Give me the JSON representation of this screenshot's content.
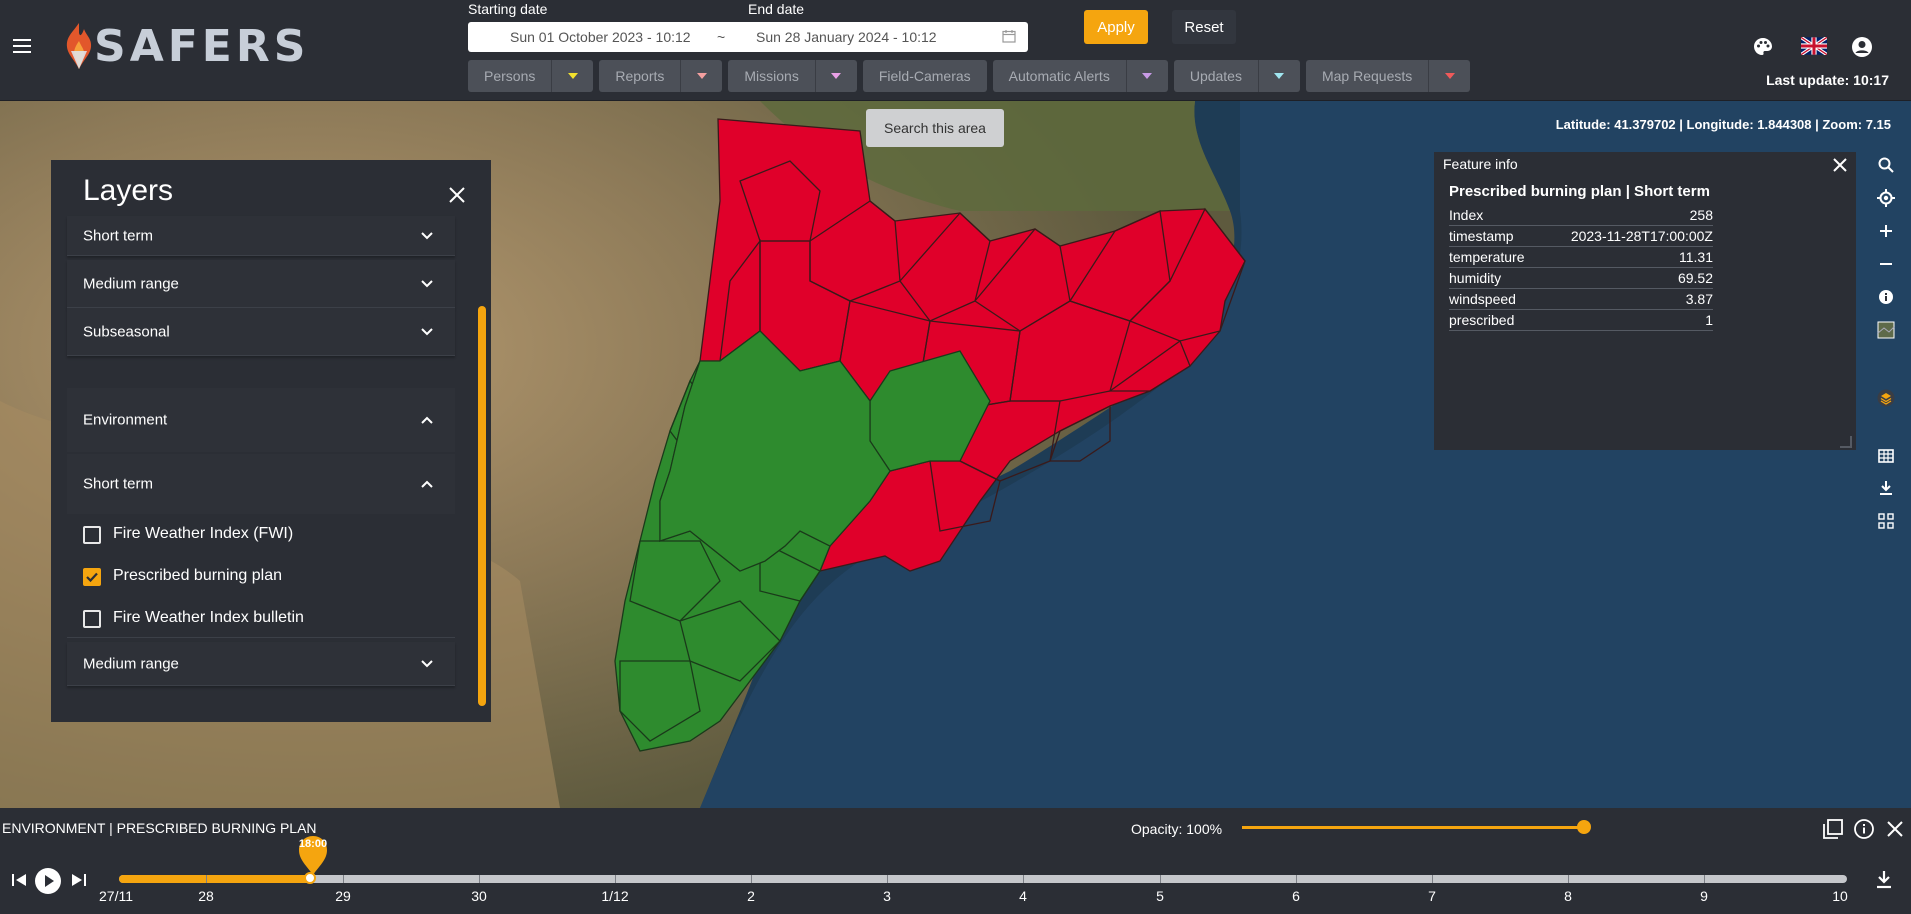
{
  "header": {
    "logo_text": "SAFERS",
    "starting_date_label": "Starting date",
    "end_date_label": "End date",
    "start_value": "Sun 01 October 2023 - 10:12",
    "separator": "~",
    "end_value": "Sun 28 January 2024 - 10:12",
    "apply_label": "Apply",
    "reset_label": "Reset",
    "filters": [
      {
        "label": "Persons",
        "color": "#f2e12e"
      },
      {
        "label": "Reports",
        "color": "#f4a0a0"
      },
      {
        "label": "Missions",
        "color": "#e9a0e6"
      },
      {
        "label": "Field-Cameras"
      },
      {
        "label": "Automatic Alerts",
        "color": "#c89be6"
      },
      {
        "label": "Updates",
        "color": "#a0e6f0"
      },
      {
        "label": "Map Requests",
        "color": "#f05a5a"
      }
    ],
    "last_update": "Last update: 10:17"
  },
  "map": {
    "search_area": "Search this area",
    "coordinates": "Latitude: 41.379702 | Longitude: 1.844308 | Zoom: 7.15"
  },
  "layers": {
    "title": "Layers",
    "rows": [
      {
        "label": "Short term"
      },
      {
        "label": "Medium range"
      },
      {
        "label": "Subseasonal"
      },
      {
        "label": "Environment"
      },
      {
        "label": "Short term"
      },
      {
        "label": "Medium range"
      }
    ],
    "checkboxes": [
      {
        "label": "Fire Weather Index (FWI)",
        "checked": false
      },
      {
        "label": "Prescribed burning plan",
        "checked": true
      },
      {
        "label": "Fire Weather Index bulletin",
        "checked": false
      }
    ]
  },
  "feature_info": {
    "header": "Feature info",
    "title": "Prescribed burning plan | Short term",
    "rows": [
      {
        "key": "Index",
        "value": "258"
      },
      {
        "key": "timestamp",
        "value": "2023-11-28T17:00:00Z"
      },
      {
        "key": "temperature",
        "value": "11.31"
      },
      {
        "key": "humidity",
        "value": "69.52"
      },
      {
        "key": "windspeed",
        "value": "3.87"
      },
      {
        "key": "prescribed",
        "value": "1"
      }
    ]
  },
  "timeline": {
    "layer_name": "ENVIRONMENT | PRESCRIBED BURNING PLAN",
    "opacity_label": "Opacity: 100%",
    "opacity_value": 1.0,
    "current_time": "18:00",
    "labels": [
      "27/11",
      "28",
      "29",
      "30",
      "1/12",
      "2",
      "3",
      "4",
      "5",
      "6",
      "7",
      "8",
      "9",
      "10"
    ]
  },
  "colors": {
    "accent": "#f5a50f",
    "region_red": "#e0002a",
    "region_green": "#2e8b2e",
    "panel_bg": "#2b2e35"
  }
}
